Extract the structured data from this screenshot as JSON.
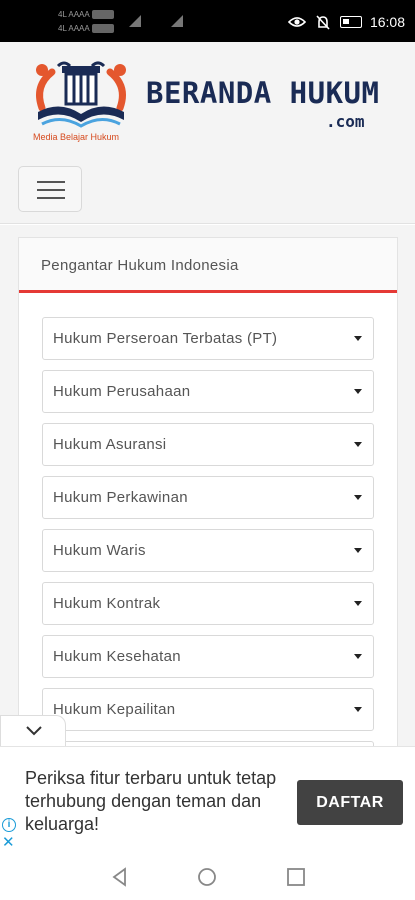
{
  "status_bar": {
    "carrier_1": "4L AAAA",
    "carrier_2": "4L AAAA",
    "time": "16:08",
    "icons": [
      "eye-icon",
      "mute-icon",
      "battery-icon"
    ]
  },
  "header": {
    "tagline": "Media Belajar Hukum",
    "brand_name": "BERANDA HUKUM",
    "brand_tld": ".com",
    "menu_icon": "hamburger-icon"
  },
  "sidebar_card": {
    "title": "Pengantar Hukum Indonesia",
    "dropdowns": [
      {
        "label": "Hukum Perseroan Terbatas (PT)"
      },
      {
        "label": "Hukum Perusahaan"
      },
      {
        "label": "Hukum Asuransi"
      },
      {
        "label": "Hukum Perkawinan"
      },
      {
        "label": "Hukum Waris"
      },
      {
        "label": "Hukum Kontrak"
      },
      {
        "label": "Hukum Kesehatan"
      },
      {
        "label": "Hukum Kepailitan"
      },
      {
        "label": ""
      }
    ]
  },
  "ad": {
    "text": "Periksa fitur terbaru untuk tetap terhubung dengan teman dan keluarga!",
    "button_label": "DAFTAR",
    "info_glyph": "i",
    "close_glyph": "✕"
  },
  "colors": {
    "accent_red": "#e53935",
    "brand_navy": "#1a2b55",
    "logo_orange": "#e4572e",
    "ad_button": "#424242",
    "ad_choices_blue": "#1a9bd7"
  }
}
